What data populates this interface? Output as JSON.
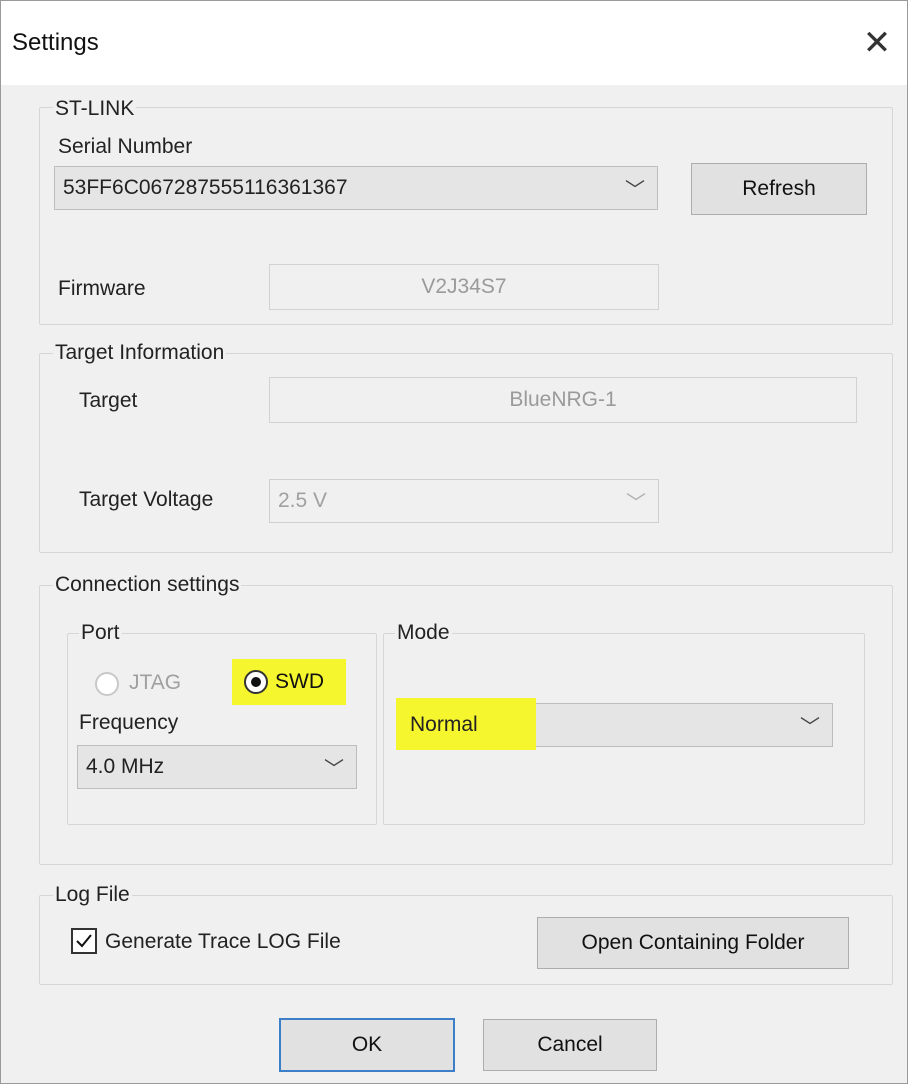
{
  "window": {
    "title": "Settings",
    "close_glyph": "✕"
  },
  "stlink": {
    "legend": "ST-LINK",
    "serial_label": "Serial Number",
    "serial_value": "53FF6C067287555116361367",
    "refresh_label": "Refresh",
    "firmware_label": "Firmware",
    "firmware_value": "V2J34S7"
  },
  "target": {
    "legend": "Target Information",
    "target_label": "Target",
    "target_value": "BlueNRG-1",
    "voltage_label": "Target Voltage",
    "voltage_value": "2.5 V"
  },
  "connection": {
    "legend": "Connection settings",
    "port": {
      "legend": "Port",
      "options": [
        {
          "label": "JTAG",
          "selected": false,
          "enabled": false
        },
        {
          "label": "SWD",
          "selected": true,
          "enabled": true
        }
      ],
      "frequency_label": "Frequency",
      "frequency_value": "4.0 MHz"
    },
    "mode": {
      "legend": "Mode",
      "value": "Normal"
    }
  },
  "log": {
    "legend": "Log File",
    "checkbox_label": "Generate Trace LOG File",
    "checked": true,
    "open_folder_label": "Open Containing Folder"
  },
  "footer": {
    "ok_label": "OK",
    "cancel_label": "Cancel"
  },
  "icons": {
    "dropdown": "chevron-down-icon",
    "close": "close-icon",
    "check": "checkmark-icon"
  },
  "colors": {
    "highlight": "#f6f62e",
    "default_button_border": "#3c7fc8",
    "dialog_bg": "#f0f0f0"
  }
}
